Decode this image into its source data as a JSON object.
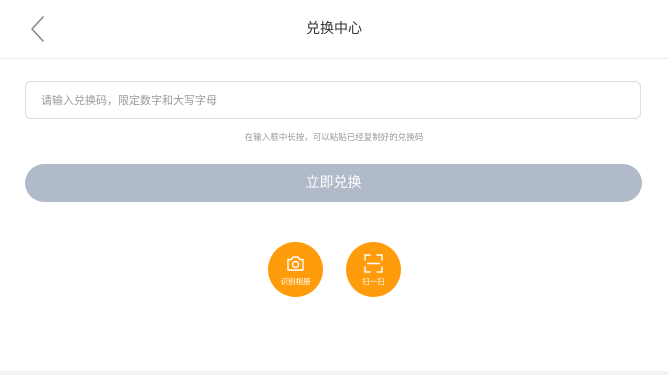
{
  "header": {
    "back_icon": "chevron-left-icon",
    "title": "兑换中心"
  },
  "redeem": {
    "input_placeholder": "请输入兑换码，限定数字和大写字母",
    "input_value": "",
    "hint": "在输入框中长按，可以粘贴已经复制好的兑换码",
    "button_label": "立即兑换",
    "button_color": "#b0bac8"
  },
  "actions": {
    "accent_color": "#ff9c0c",
    "album": {
      "label": "识别相册",
      "icon": "camera-icon"
    },
    "scan": {
      "label": "扫一扫",
      "icon": "scan-icon"
    }
  }
}
